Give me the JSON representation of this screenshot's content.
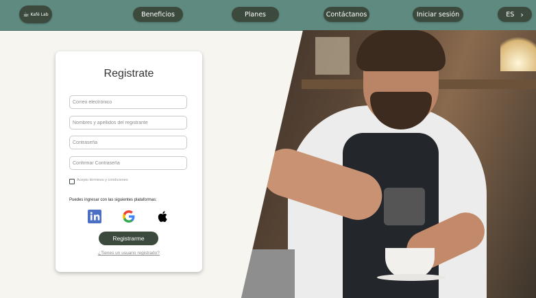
{
  "nav": {
    "logo_text": "Kafé Lab",
    "items": [
      "Beneficios",
      "Planes",
      "Contáctanos",
      "Iniciar sesión"
    ],
    "language": "ES",
    "language_icon": "chevron-right-icon"
  },
  "form": {
    "title": "Registrate",
    "email_placeholder": "Correo electrónico",
    "name_placeholder": "Nombres y apellidos del registrante",
    "password_placeholder": "Contraseña",
    "confirm_placeholder": "Confirmar Contraseña",
    "terms_label": "Acepto términos y condiciones",
    "platforms_label": "Puedes ingresar con las siguientes plataformas:",
    "social_icons": [
      "linkedin-icon",
      "google-icon",
      "apple-icon"
    ],
    "submit_label": "Registrarme",
    "login_link": "¿Tienes un usuario registrado?"
  },
  "colors": {
    "nav_bg": "#5f8a80",
    "pill_bg": "#3c4a3d",
    "page_bg": "#f7f5f0"
  }
}
